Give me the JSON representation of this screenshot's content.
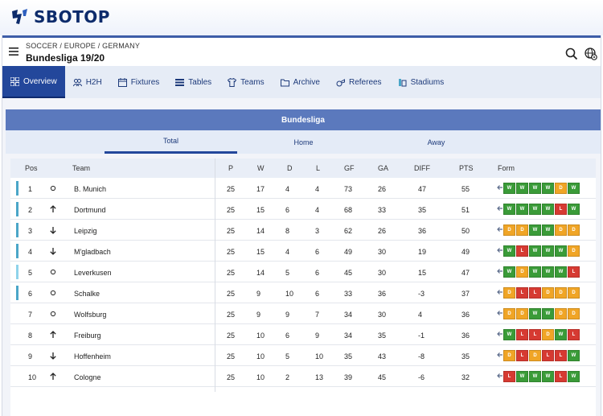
{
  "brand": {
    "name": "SBOTOP"
  },
  "header": {
    "breadcrumb": "SOCCER / EUROPE / GERMANY",
    "title": "Bundesliga 19/20",
    "icons": [
      "menu-icon",
      "search-icon",
      "globe-settings-icon"
    ]
  },
  "nav": {
    "items": [
      {
        "label": "Overview",
        "icon": "overview-icon",
        "active": true
      },
      {
        "label": "H2H",
        "icon": "h2h-icon"
      },
      {
        "label": "Fixtures",
        "icon": "calendar-icon"
      },
      {
        "label": "Tables",
        "icon": "tables-icon"
      },
      {
        "label": "Teams",
        "icon": "shirt-icon"
      },
      {
        "label": "Archive",
        "icon": "folder-icon"
      },
      {
        "label": "Referees",
        "icon": "whistle-icon"
      },
      {
        "label": "Stadiums",
        "icon": "stadium-icon"
      }
    ]
  },
  "league": {
    "name": "Bundesliga"
  },
  "view_tabs": [
    {
      "label": "Total",
      "active": true
    },
    {
      "label": "Home"
    },
    {
      "label": "Away"
    }
  ],
  "table": {
    "columns": [
      "Pos",
      "Team",
      "P",
      "W",
      "D",
      "L",
      "GF",
      "GA",
      "DIFF",
      "PTS",
      "Form"
    ],
    "colors": {
      "W": "#3a9b38",
      "D": "#f0a526",
      "L": "#d63a32",
      "marker_cl": "#4aa6c8",
      "marker_el": "#8fd3ea"
    },
    "rows": [
      {
        "pos": "1",
        "trend": "same",
        "marker": "cl",
        "team": "B. Munich",
        "p": "25",
        "w": "17",
        "d": "4",
        "l": "4",
        "gf": "73",
        "ga": "26",
        "diff": "47",
        "pts": "55",
        "form": [
          "W",
          "W",
          "W",
          "W",
          "D",
          "W"
        ]
      },
      {
        "pos": "2",
        "trend": "up",
        "marker": "cl",
        "team": "Dortmund",
        "p": "25",
        "w": "15",
        "d": "6",
        "l": "4",
        "gf": "68",
        "ga": "33",
        "diff": "35",
        "pts": "51",
        "form": [
          "W",
          "W",
          "W",
          "W",
          "L",
          "W"
        ]
      },
      {
        "pos": "3",
        "trend": "down",
        "marker": "cl",
        "team": "Leipzig",
        "p": "25",
        "w": "14",
        "d": "8",
        "l": "3",
        "gf": "62",
        "ga": "26",
        "diff": "36",
        "pts": "50",
        "form": [
          "D",
          "D",
          "W",
          "W",
          "D",
          "D"
        ]
      },
      {
        "pos": "4",
        "trend": "down",
        "marker": "cl",
        "team": "M'gladbach",
        "p": "25",
        "w": "15",
        "d": "4",
        "l": "6",
        "gf": "49",
        "ga": "30",
        "diff": "19",
        "pts": "49",
        "form": [
          "W",
          "L",
          "W",
          "W",
          "W",
          "D"
        ]
      },
      {
        "pos": "5",
        "trend": "same",
        "marker": "el",
        "team": "Leverkusen",
        "p": "25",
        "w": "14",
        "d": "5",
        "l": "6",
        "gf": "45",
        "ga": "30",
        "diff": "15",
        "pts": "47",
        "form": [
          "W",
          "D",
          "W",
          "W",
          "W",
          "L"
        ]
      },
      {
        "pos": "6",
        "trend": "same",
        "marker": "cl",
        "team": "Schalke",
        "p": "25",
        "w": "9",
        "d": "10",
        "l": "6",
        "gf": "33",
        "ga": "36",
        "diff": "-3",
        "pts": "37",
        "form": [
          "D",
          "L",
          "L",
          "D",
          "D",
          "D"
        ]
      },
      {
        "pos": "7",
        "trend": "same",
        "marker": "none",
        "team": "Wolfsburg",
        "p": "25",
        "w": "9",
        "d": "9",
        "l": "7",
        "gf": "34",
        "ga": "30",
        "diff": "4",
        "pts": "36",
        "form": [
          "D",
          "D",
          "W",
          "W",
          "D",
          "D"
        ]
      },
      {
        "pos": "8",
        "trend": "up",
        "marker": "none",
        "team": "Freiburg",
        "p": "25",
        "w": "10",
        "d": "6",
        "l": "9",
        "gf": "34",
        "ga": "35",
        "diff": "-1",
        "pts": "36",
        "form": [
          "W",
          "L",
          "L",
          "D",
          "W",
          "L"
        ]
      },
      {
        "pos": "9",
        "trend": "down",
        "marker": "none",
        "team": "Hoffenheim",
        "p": "25",
        "w": "10",
        "d": "5",
        "l": "10",
        "gf": "35",
        "ga": "43",
        "diff": "-8",
        "pts": "35",
        "form": [
          "D",
          "L",
          "D",
          "L",
          "L",
          "W"
        ]
      },
      {
        "pos": "10",
        "trend": "up",
        "marker": "none",
        "team": "Cologne",
        "p": "25",
        "w": "10",
        "d": "2",
        "l": "13",
        "gf": "39",
        "ga": "45",
        "diff": "-6",
        "pts": "32",
        "form": [
          "L",
          "W",
          "W",
          "W",
          "L",
          "W"
        ]
      }
    ]
  }
}
